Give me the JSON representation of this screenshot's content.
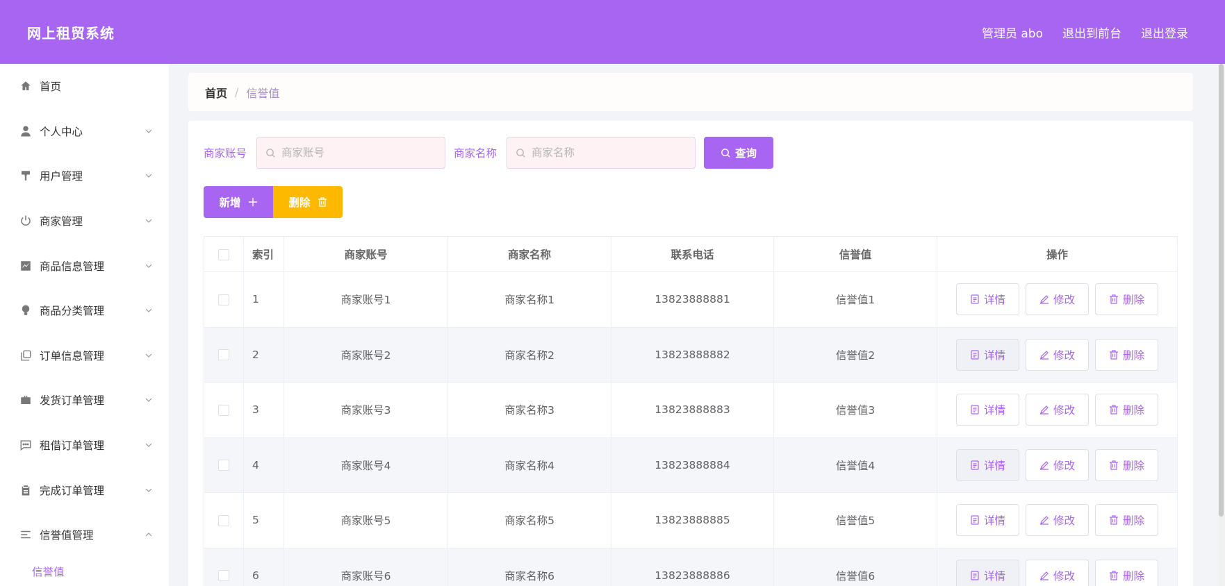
{
  "header": {
    "brand": "网上租贸系统",
    "links": [
      "管理员 abo",
      "退出到前台",
      "退出登录"
    ]
  },
  "sidebar": {
    "items": [
      {
        "label": "首页",
        "icon": "home-icon"
      },
      {
        "label": "个人中心",
        "icon": "user-icon"
      },
      {
        "label": "用户管理",
        "icon": "paint-roller-icon"
      },
      {
        "label": "商家管理",
        "icon": "power-icon"
      },
      {
        "label": "商品信息管理",
        "icon": "chart-icon"
      },
      {
        "label": "商品分类管理",
        "icon": "bulb-icon"
      },
      {
        "label": "订单信息管理",
        "icon": "copy-icon"
      },
      {
        "label": "发货订单管理",
        "icon": "briefcase-icon"
      },
      {
        "label": "租借订单管理",
        "icon": "chat-icon"
      },
      {
        "label": "完成订单管理",
        "icon": "clipboard-icon"
      },
      {
        "label": "信誉值管理",
        "icon": "menu-lines-icon"
      }
    ],
    "submenu_active": "信誉值"
  },
  "breadcrumb": {
    "home": "首页",
    "separator": "/",
    "current": "信誉值"
  },
  "search": {
    "account_label": "商家账号",
    "account_placeholder": "商家账号",
    "name_label": "商家名称",
    "name_placeholder": "商家名称",
    "query_button": "查询"
  },
  "actions": {
    "add_label": "新增",
    "delete_label": "删除"
  },
  "table": {
    "columns": [
      "索引",
      "商家账号",
      "商家名称",
      "联系电话",
      "信誉值",
      "操作"
    ],
    "rows": [
      {
        "idx": "1",
        "account": "商家账号1",
        "name": "商家名称1",
        "phone": "13823888881",
        "credit": "信誉值1"
      },
      {
        "idx": "2",
        "account": "商家账号2",
        "name": "商家名称2",
        "phone": "13823888882",
        "credit": "信誉值2"
      },
      {
        "idx": "3",
        "account": "商家账号3",
        "name": "商家名称3",
        "phone": "13823888883",
        "credit": "信誉值3"
      },
      {
        "idx": "4",
        "account": "商家账号4",
        "name": "商家名称4",
        "phone": "13823888884",
        "credit": "信誉值4"
      },
      {
        "idx": "5",
        "account": "商家账号5",
        "name": "商家名称5",
        "phone": "13823888885",
        "credit": "信誉值5"
      },
      {
        "idx": "6",
        "account": "商家账号6",
        "name": "商家名称6",
        "phone": "13823888886",
        "credit": "信誉值6"
      }
    ],
    "op_labels": {
      "detail": "详情",
      "edit": "修改",
      "delete": "删除"
    }
  },
  "colors": {
    "primary": "#a865f2",
    "warning": "#fcb900"
  }
}
